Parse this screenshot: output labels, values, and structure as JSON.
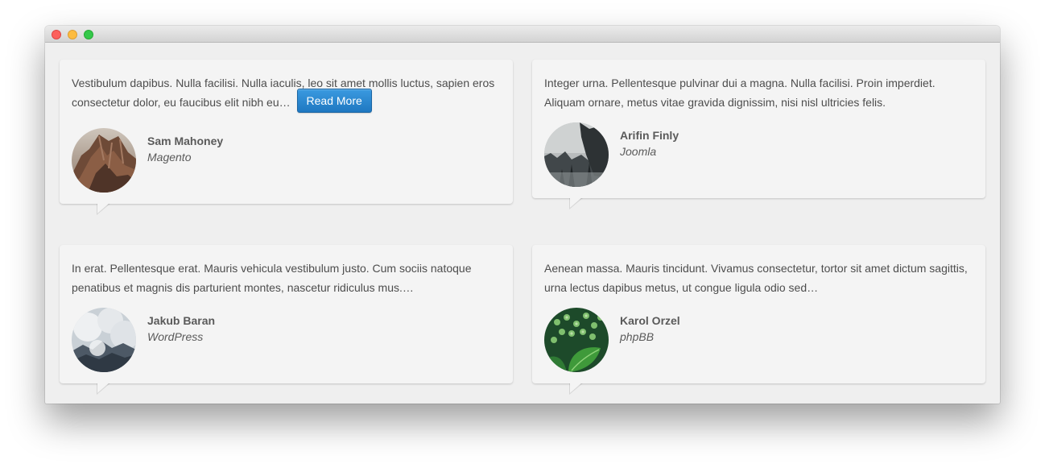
{
  "window": {
    "controls": [
      "close",
      "minimize",
      "zoom"
    ]
  },
  "testimonials": [
    {
      "quote": "Vestibulum dapibus. Nulla facilisi. Nulla iaculis, leo sit amet mollis luctus, sapien eros consectetur dolor, eu faucibus elit nibh eu…",
      "button_label": "Read More",
      "name": "Sam Mahoney",
      "role": "Magento",
      "avatar_icon": "rock-photo-icon"
    },
    {
      "quote": "Integer urna. Pellentesque pulvinar dui a magna. Nulla facilisi. Proin imperdiet. Aliquam ornare, metus vitae gravida dignissim, nisi nisl ultricies felis.",
      "name": "Arifin Finly",
      "role": "Joomla",
      "avatar_icon": "forest-photo-icon"
    },
    {
      "quote": "In erat. Pellentesque erat. Mauris vehicula vestibulum justo. Cum sociis natoque penatibus et magnis dis parturient montes, nascetur ridiculus mus.…",
      "name": "Jakub Baran",
      "role": "WordPress",
      "avatar_icon": "clouds-photo-icon"
    },
    {
      "quote": "Aenean massa. Mauris tincidunt. Vivamus consectetur, tortor sit amet dictum sagittis, urna lectus dapibus metus, ut congue ligula odio sed…",
      "name": "Karol Orzel",
      "role": "phpBB",
      "avatar_icon": "plant-photo-icon"
    }
  ],
  "colors": {
    "button": "#2384cf",
    "card": "#f4f4f4",
    "background": "#efefef"
  }
}
